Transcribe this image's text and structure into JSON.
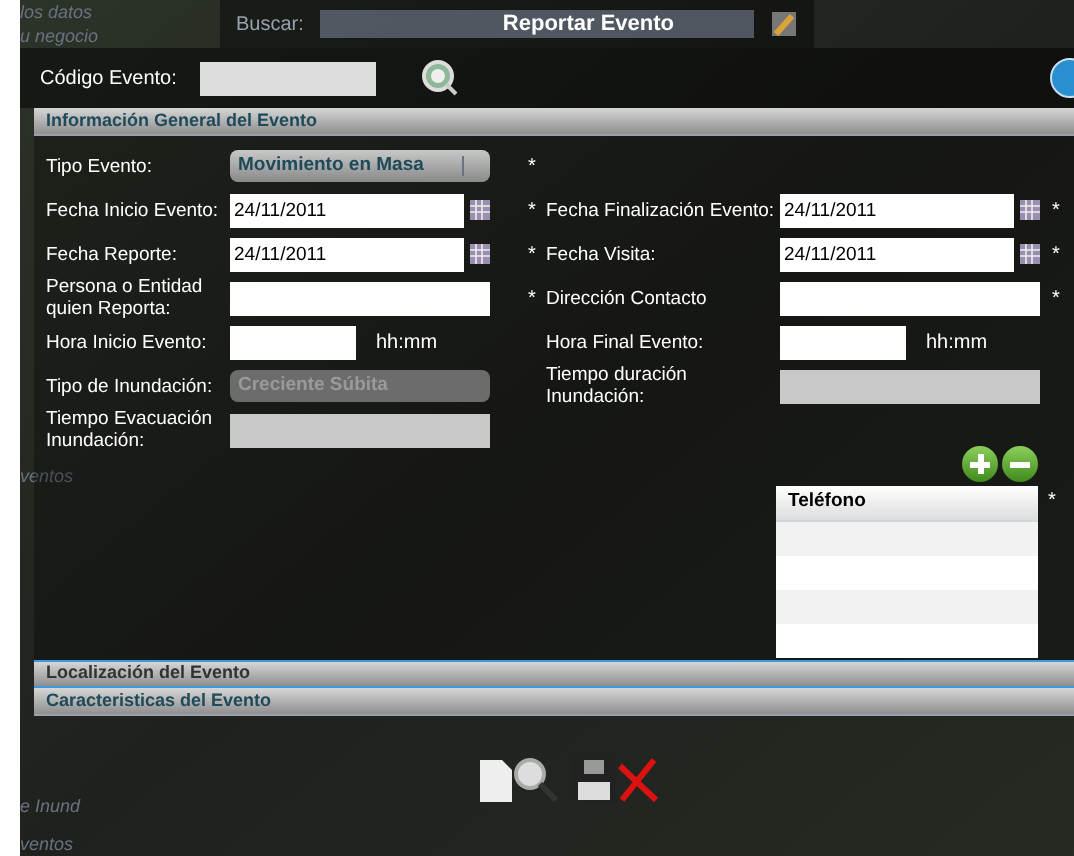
{
  "background_texts": [
    "los datos",
    "u negocio",
    "ventos",
    "e Inund",
    "ventos"
  ],
  "search": {
    "label": "Buscar:"
  },
  "window": {
    "title": "Reportar Evento"
  },
  "code_field": {
    "label": "Código Evento:"
  },
  "sections": [
    {
      "title": "Información General del Evento",
      "expanded": true,
      "selected": false
    },
    {
      "title": "Localización del Evento",
      "expanded": false,
      "selected": true
    },
    {
      "title": "Caracteristicas del Evento",
      "expanded": false,
      "selected": false
    }
  ],
  "form_rows": [
    {
      "left": {
        "label": "Tipo Evento:",
        "kind": "select",
        "value": "Movimiento en Masa",
        "required_mark": "*"
      },
      "right": null
    },
    {
      "left": {
        "label": "Fecha Inicio Evento:",
        "kind": "date",
        "value": "24/11/2011",
        "required_mark": "*"
      },
      "right": {
        "label": "Fecha Finalización Evento:",
        "kind": "date",
        "value": "24/11/2011",
        "required_mark": "*"
      }
    },
    {
      "left": {
        "label": "Fecha Reporte:",
        "kind": "date",
        "value": "24/11/2011",
        "required_mark": "*"
      },
      "right": {
        "label": "Fecha Visita:",
        "kind": "date",
        "value": "24/11/2011",
        "required_mark": "*"
      }
    },
    {
      "left": {
        "label": "Persona o Entidad quien Reporta:",
        "kind": "text",
        "required_mark": "*"
      },
      "right": {
        "label": "Dirección Contacto",
        "kind": "text",
        "required_mark": "*"
      }
    },
    {
      "left": {
        "label": "Hora Inicio Evento:",
        "kind": "time",
        "suffix": "hh:mm"
      },
      "right": {
        "label": "Hora Final Evento:",
        "kind": "time",
        "suffix": "hh:mm"
      }
    },
    {
      "left": {
        "label": "Tipo de Inundación:",
        "kind": "select",
        "value": "Creciente Súbita",
        "disabled": true
      },
      "right": {
        "label": "Tiempo duración Inundación:",
        "kind": "text",
        "disabled": true
      }
    },
    {
      "left": {
        "label": "Tiempo Evacuación Inundación:",
        "kind": "text",
        "disabled": true
      },
      "right": null
    }
  ],
  "phone_table": {
    "column": "Teléfono",
    "required_mark": "*"
  }
}
